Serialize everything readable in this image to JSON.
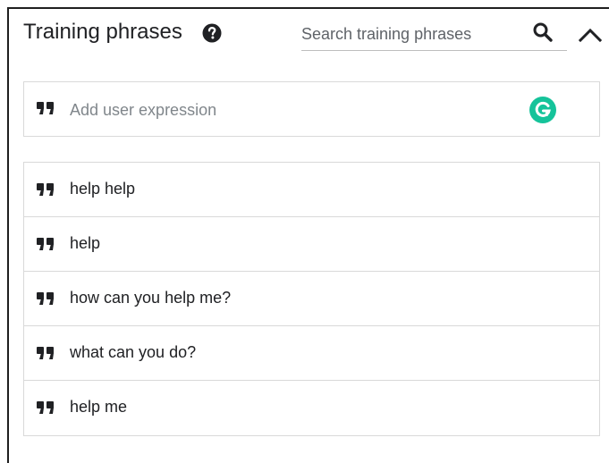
{
  "header": {
    "title": "Training phrases",
    "help_icon": "help-circle-icon",
    "search_placeholder": "Search training phrases",
    "search_value": "",
    "search_icon": "search-icon",
    "collapse_icon": "chevron-up-icon"
  },
  "add_expression": {
    "placeholder": "Add user expression",
    "value": "",
    "quote_icon": "quote-icon",
    "grammarly_icon": "grammarly-icon",
    "grammarly_color": "#15c39a"
  },
  "phrases": [
    {
      "text": "help help"
    },
    {
      "text": "help"
    },
    {
      "text": "how can you help me?"
    },
    {
      "text": "what can you do?"
    },
    {
      "text": "help me"
    }
  ]
}
